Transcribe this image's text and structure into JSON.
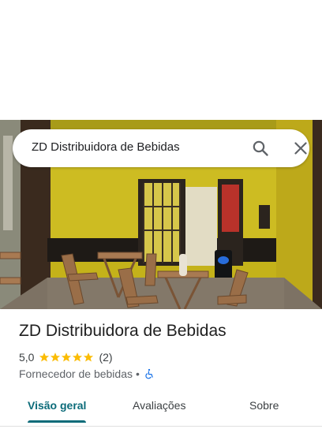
{
  "search": {
    "query": "ZD Distribuidora de Bebidas"
  },
  "place": {
    "name": "ZD Distribuidora de Bebidas",
    "rating": "5,0",
    "stars": 5,
    "review_count": "(2)",
    "category": "Fornecedor de bebidas",
    "separator": "•",
    "accessibility_icon": "wheelchair-accessible-icon"
  },
  "tabs": [
    {
      "label": "Visão geral",
      "active": true
    },
    {
      "label": "Avaliações",
      "active": false
    },
    {
      "label": "Sobre",
      "active": false
    }
  ],
  "colors": {
    "accent": "#0b6b79",
    "star": "#fbbc04",
    "wall_yellow": "#c9b81e"
  },
  "icons": {
    "search": "search-icon",
    "close": "close-icon"
  }
}
